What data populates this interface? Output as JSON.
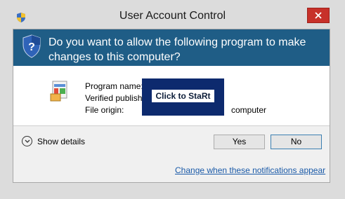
{
  "window": {
    "title": "User Account Control"
  },
  "banner": {
    "question": "Do you want to allow the following program to make changes to this computer?"
  },
  "info": {
    "program_name_label": "Program name:",
    "verified_publisher_label": "Verified publisher:",
    "file_origin_label": "File origin:",
    "file_origin_value": "computer"
  },
  "overlay": {
    "label": "Click to StaRt"
  },
  "footer": {
    "show_details": "Show details",
    "yes": "Yes",
    "no": "No",
    "change_link": "Change when these notifications appear"
  },
  "icons": {
    "title": "uac-shield-icon",
    "banner": "uac-shield-icon",
    "program": "program-icon",
    "close": "close-icon",
    "details": "chevron-down-icon"
  },
  "colors": {
    "banner": "#1f5d86",
    "close": "#c7312a",
    "overlay": "#0d2a6e",
    "link": "#1a5aa8"
  }
}
